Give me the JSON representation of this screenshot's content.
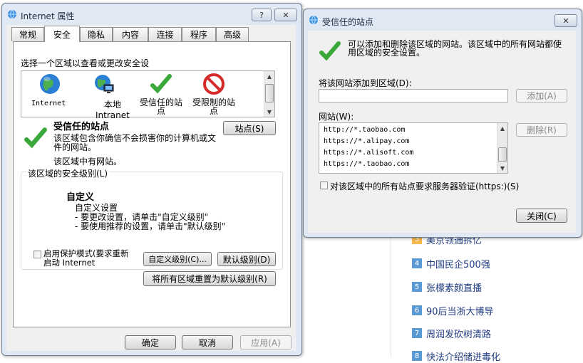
{
  "background": {
    "ranking": [
      {
        "num": "3",
        "text": "美京领通拆亿",
        "hot": true
      },
      {
        "num": "4",
        "text": "中国民企500强",
        "hot": false
      },
      {
        "num": "5",
        "text": "张檬素颜直播",
        "hot": false
      },
      {
        "num": "6",
        "text": "90后当浙大博导",
        "hot": false
      },
      {
        "num": "7",
        "text": "周润发砍树清路",
        "hot": false
      },
      {
        "num": "8",
        "text": "快法介绍储进毒化",
        "hot": false
      }
    ]
  },
  "internet_options": {
    "title": "Internet 属性",
    "help_btn": "?",
    "close_btn": "✕",
    "tabs": [
      "常规",
      "安全",
      "隐私",
      "内容",
      "连接",
      "程序",
      "高级"
    ],
    "active_tab": "安全",
    "zone_prompt": "选择一个区域以查看或更改安全设",
    "zones": [
      {
        "label": "Internet",
        "icon": "globe-icon"
      },
      {
        "label": "本地\nIntranet",
        "icon": "intranet-icon"
      },
      {
        "label": "受信任的站\n点",
        "icon": "checkmark-icon"
      },
      {
        "label": "受限制的站\n点",
        "icon": "restricted-icon"
      }
    ],
    "zone_title": "受信任的站点",
    "zone_desc": "该区域包含你确信不会损害你的计算机或文\n件的网站。",
    "zone_has_sites": "该区域中有网站。",
    "sites_btn": "站点(S)",
    "security_level_label": "该区域的安全级别(L)",
    "custom_title": "自定义",
    "custom_line1": "自定义设置",
    "custom_line2": "- 要更改设置，请单击\"自定义级别\"",
    "custom_line3": "- 要使用推荐的设置，请单击\"默认级别\"",
    "protected_mode_label": "启用保护模式(要求重新\n启动 Internet",
    "custom_level_btn": "自定义级别(C)...",
    "default_level_btn": "默认级别(D)",
    "reset_all_btn": "将所有区域重置为默认级别(R)",
    "ok_btn": "确定",
    "cancel_btn": "取消",
    "apply_btn": "应用(A)"
  },
  "trusted_sites": {
    "title": "受信任的站点",
    "close_btn": "✕",
    "info": "可以添加和删除该区域的网站。该区域中的所有网站都使\n用区域的安全设置。",
    "add_label": "将该网站添加到区域(D):",
    "add_input_value": "",
    "add_btn": "添加(A)",
    "websites_label": "网站(W):",
    "websites": [
      "http://*.taobao.com",
      "https://*.alipay.com",
      "https://*.alisoft.com",
      "https://*.taobao.com"
    ],
    "remove_btn": "删除(R)",
    "verify_label": "对该区域中的所有站点要求服务器验证(https:)(S)",
    "close_dialog_btn": "关闭(C)"
  }
}
